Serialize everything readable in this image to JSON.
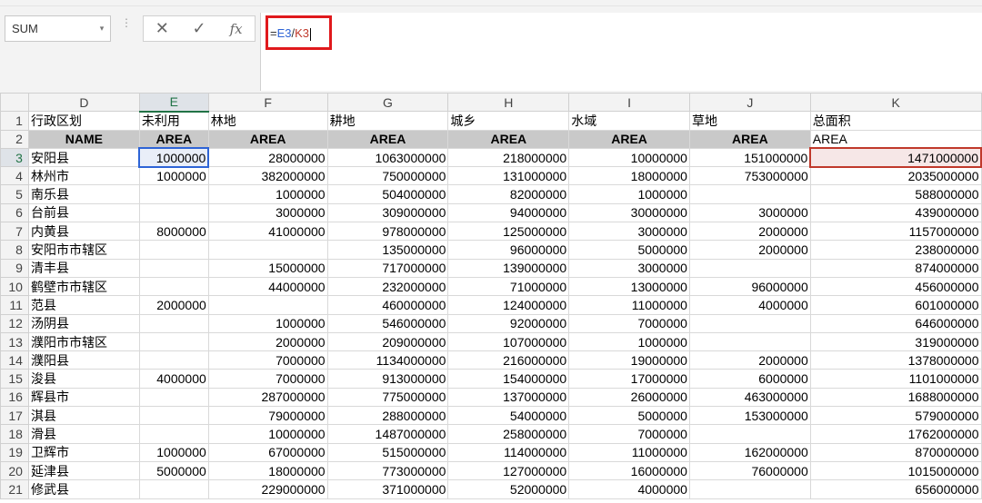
{
  "formula_bar": {
    "name_box": "SUM",
    "name_box_arrow": "▾",
    "dots": "⋮",
    "cancel": "✕",
    "enter": "✓",
    "fx": "fx",
    "formula_prefix": "=",
    "formula_ref1": "E3",
    "formula_sep": "/",
    "formula_ref2": "K3"
  },
  "columns": [
    "D",
    "E",
    "F",
    "G",
    "H",
    "I",
    "J",
    "K"
  ],
  "row1": [
    "行政区划",
    "未利用",
    "林地",
    "耕地",
    "城乡",
    "水域",
    "草地",
    "总面积"
  ],
  "row2": [
    "NAME",
    "AREA",
    "AREA",
    "AREA",
    "AREA",
    "AREA",
    "AREA",
    "AREA"
  ],
  "rows": [
    {
      "n": "3",
      "c": [
        "安阳县",
        "1000000",
        "28000000",
        "1063000000",
        "218000000",
        "10000000",
        "151000000",
        "1471000000"
      ]
    },
    {
      "n": "4",
      "c": [
        "林州市",
        "1000000",
        "382000000",
        "750000000",
        "131000000",
        "18000000",
        "753000000",
        "2035000000"
      ]
    },
    {
      "n": "5",
      "c": [
        "南乐县",
        "",
        "1000000",
        "504000000",
        "82000000",
        "1000000",
        "",
        "588000000"
      ]
    },
    {
      "n": "6",
      "c": [
        "台前县",
        "",
        "3000000",
        "309000000",
        "94000000",
        "30000000",
        "3000000",
        "439000000"
      ]
    },
    {
      "n": "7",
      "c": [
        "内黄县",
        "8000000",
        "41000000",
        "978000000",
        "125000000",
        "3000000",
        "2000000",
        "1157000000"
      ]
    },
    {
      "n": "8",
      "c": [
        "安阳市市辖区",
        "",
        "",
        "135000000",
        "96000000",
        "5000000",
        "2000000",
        "238000000"
      ]
    },
    {
      "n": "9",
      "c": [
        "清丰县",
        "",
        "15000000",
        "717000000",
        "139000000",
        "3000000",
        "",
        "874000000"
      ]
    },
    {
      "n": "10",
      "c": [
        "鹤壁市市辖区",
        "",
        "44000000",
        "232000000",
        "71000000",
        "13000000",
        "96000000",
        "456000000"
      ]
    },
    {
      "n": "11",
      "c": [
        "范县",
        "2000000",
        "",
        "460000000",
        "124000000",
        "11000000",
        "4000000",
        "601000000"
      ]
    },
    {
      "n": "12",
      "c": [
        "汤阴县",
        "",
        "1000000",
        "546000000",
        "92000000",
        "7000000",
        "",
        "646000000"
      ]
    },
    {
      "n": "13",
      "c": [
        "濮阳市市辖区",
        "",
        "2000000",
        "209000000",
        "107000000",
        "1000000",
        "",
        "319000000"
      ]
    },
    {
      "n": "14",
      "c": [
        "濮阳县",
        "",
        "7000000",
        "1134000000",
        "216000000",
        "19000000",
        "2000000",
        "1378000000"
      ]
    },
    {
      "n": "15",
      "c": [
        "浚县",
        "4000000",
        "7000000",
        "913000000",
        "154000000",
        "17000000",
        "6000000",
        "1101000000"
      ]
    },
    {
      "n": "16",
      "c": [
        "辉县市",
        "",
        "287000000",
        "775000000",
        "137000000",
        "26000000",
        "463000000",
        "1688000000"
      ]
    },
    {
      "n": "17",
      "c": [
        "淇县",
        "",
        "79000000",
        "288000000",
        "54000000",
        "5000000",
        "153000000",
        "579000000"
      ]
    },
    {
      "n": "18",
      "c": [
        "滑县",
        "",
        "10000000",
        "1487000000",
        "258000000",
        "7000000",
        "",
        "1762000000"
      ]
    },
    {
      "n": "19",
      "c": [
        "卫辉市",
        "1000000",
        "67000000",
        "515000000",
        "114000000",
        "11000000",
        "162000000",
        "870000000"
      ]
    },
    {
      "n": "20",
      "c": [
        "延津县",
        "5000000",
        "18000000",
        "773000000",
        "127000000",
        "16000000",
        "76000000",
        "1015000000"
      ]
    },
    {
      "n": "21",
      "c": [
        "修武县",
        "",
        "229000000",
        "371000000",
        "52000000",
        "4000000",
        "",
        "656000000"
      ]
    }
  ],
  "colors": {
    "selection_e": "#2e64d6",
    "selection_k": "#c0392b",
    "highlight_box": "#e0191c",
    "header_active": "#217346"
  }
}
